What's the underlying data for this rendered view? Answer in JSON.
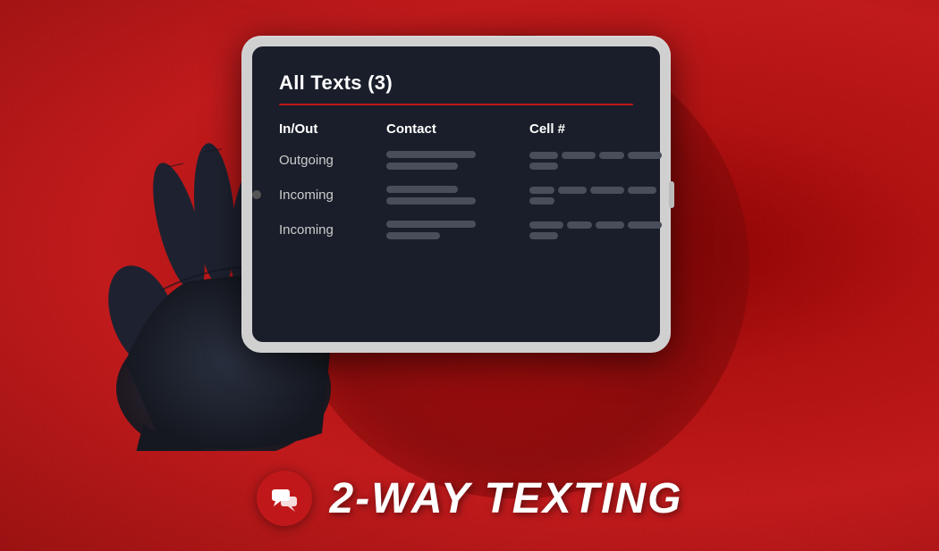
{
  "background": {
    "primary_color": "#c0181a",
    "circle_color": "#7a0808"
  },
  "tablet": {
    "screen_title": "All Texts (3)",
    "divider_color": "#c0181a",
    "table": {
      "headers": [
        "In/Out",
        "Contact",
        "Cell #"
      ],
      "rows": [
        {
          "direction": "Outgoing",
          "contact_redacted": true,
          "cell_redacted": true
        },
        {
          "direction": "Incoming",
          "contact_redacted": true,
          "cell_redacted": true
        },
        {
          "direction": "Incoming",
          "contact_redacted": true,
          "cell_redacted": true
        }
      ]
    }
  },
  "bottom_bar": {
    "title": "2-WAY TEXTING",
    "icon_label": "chat-bubbles-icon",
    "icon_bg_color": "#c0181a"
  }
}
